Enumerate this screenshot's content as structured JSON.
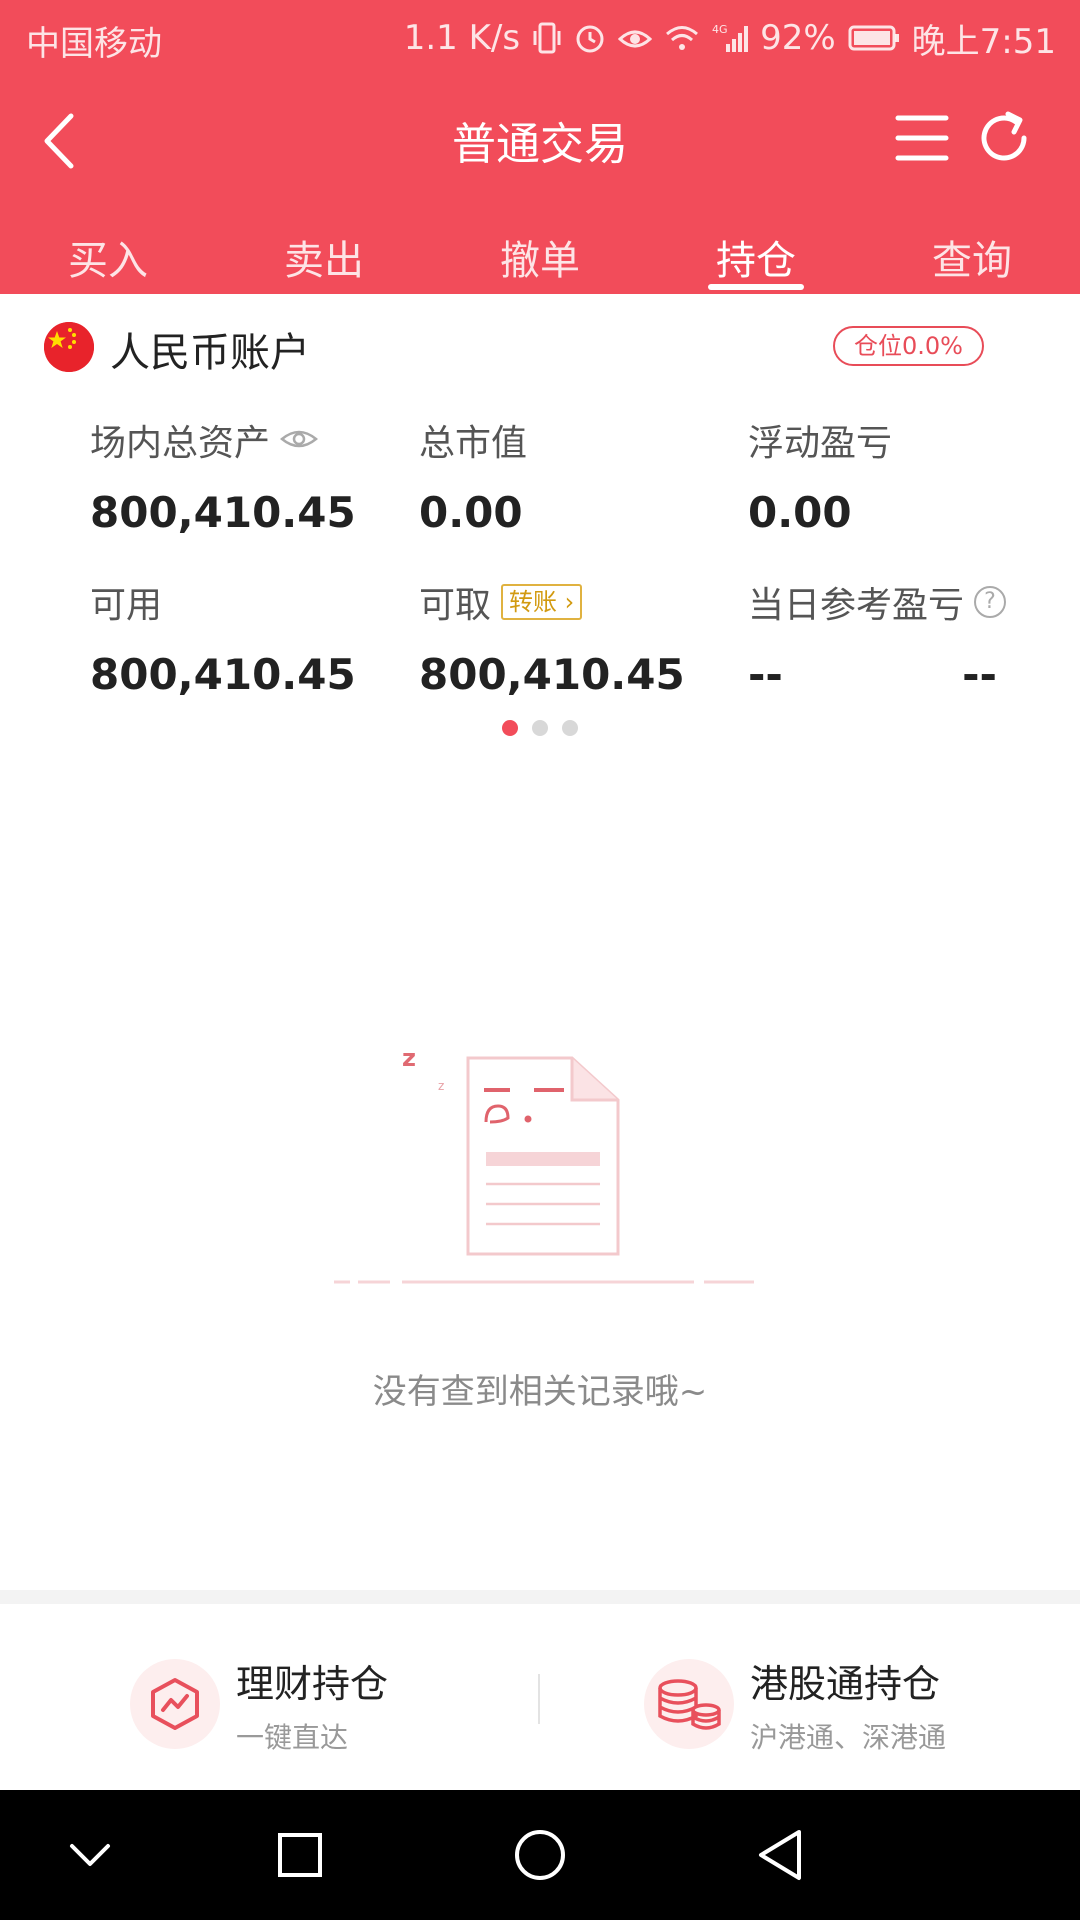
{
  "status_bar": {
    "carrier": "中国移动",
    "network_speed": "1.1 K/s",
    "battery": "92%",
    "time": "晚上7:51"
  },
  "header": {
    "title": "普通交易",
    "back_icon": "chevron-left-icon",
    "menu_icon": "menu-icon",
    "refresh_icon": "refresh-icon"
  },
  "tabs": [
    {
      "label": "买入",
      "active": false
    },
    {
      "label": "卖出",
      "active": false
    },
    {
      "label": "撤单",
      "active": false
    },
    {
      "label": "持仓",
      "active": true
    },
    {
      "label": "查询",
      "active": false
    }
  ],
  "account": {
    "name": "人民币账户",
    "position_badge": "仓位0.0%"
  },
  "stats": {
    "total_assets_label": "场内总资产",
    "total_assets_value": "800,410.45",
    "market_value_label": "总市值",
    "market_value_value": "0.00",
    "floating_pl_label": "浮动盈亏",
    "floating_pl_value": "0.00",
    "available_label": "可用",
    "available_value": "800,410.45",
    "withdrawable_label": "可取",
    "transfer_badge": "转账",
    "withdrawable_value": "800,410.45",
    "daily_pl_label": "当日参考盈亏",
    "daily_pl_value_1": "--",
    "daily_pl_value_2": "--",
    "help_mark": "?"
  },
  "pager": {
    "count": 3,
    "active_index": 0
  },
  "empty_state": {
    "message": "没有查到相关记录哦~"
  },
  "shortcuts": [
    {
      "title": "理财持仓",
      "subtitle": "一键直达",
      "icon": "wealth-chart-icon"
    },
    {
      "title": "港股通持仓",
      "subtitle": "沪港通、深港通",
      "icon": "coins-stack-icon"
    }
  ],
  "colors": {
    "brand": "#f24c5a",
    "badge_gold": "#d29a10"
  }
}
